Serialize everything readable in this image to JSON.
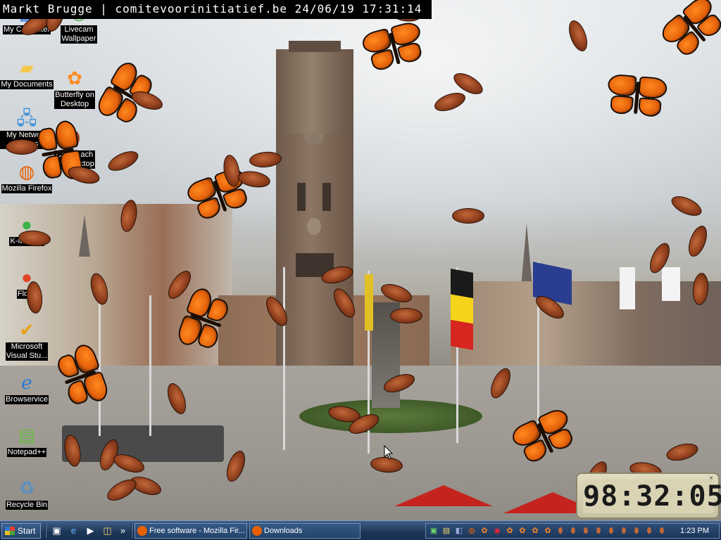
{
  "webcam": {
    "caption": "Markt Brugge | comitevoorinitiatief.be 24/06/19 17:31:14"
  },
  "desktop_icons": [
    {
      "label": "My Computer",
      "icon": "my-computer-icon"
    },
    {
      "label": "Livecam\nWallpaper",
      "icon": "livecam-icon"
    },
    {
      "label": "My Documents",
      "icon": "folder-icon"
    },
    {
      "label": "Butterfly on\nDesktop",
      "icon": "butterfly-icon"
    },
    {
      "label": "My Network Places",
      "icon": "network-icon"
    },
    {
      "label": "Cockroach\non Desktop",
      "icon": "cockroach-icon"
    },
    {
      "label": "Mozilla Firefox",
      "icon": "firefox-icon"
    },
    {
      "label": "K-Meleon",
      "icon": "k-meleon-icon"
    },
    {
      "label": "Flock",
      "icon": "flock-icon"
    },
    {
      "label": "Microsoft\nVisual Stu...",
      "icon": "visual-studio-icon"
    },
    {
      "label": "Browservice",
      "icon": "internet-explorer-icon"
    },
    {
      "label": "Notepad++",
      "icon": "notepad-plus-icon"
    },
    {
      "label": "Recycle Bin",
      "icon": "recycle-bin-icon"
    }
  ],
  "clock_widget": {
    "time": "98:32:05",
    "close_glyph": "×"
  },
  "taskbar": {
    "start_label": "Start",
    "quick_launch": [
      {
        "icon": "show-desktop-icon",
        "glyph": "▣"
      },
      {
        "icon": "internet-explorer-icon",
        "glyph": "e"
      },
      {
        "icon": "media-player-icon",
        "glyph": "▶"
      },
      {
        "icon": "explorer-icon",
        "glyph": "◫"
      }
    ],
    "overflow_glyph": "»",
    "tasks": [
      {
        "label": "Free software - Mozilla Fir...",
        "icon": "firefox-icon"
      },
      {
        "label": "Downloads",
        "icon": "firefox-icon"
      }
    ],
    "tray_time": "1:23 PM"
  },
  "colors": {
    "butterfly": "#ff8a1f",
    "taskbar": "#1d3657",
    "label_bg": "#000000"
  }
}
